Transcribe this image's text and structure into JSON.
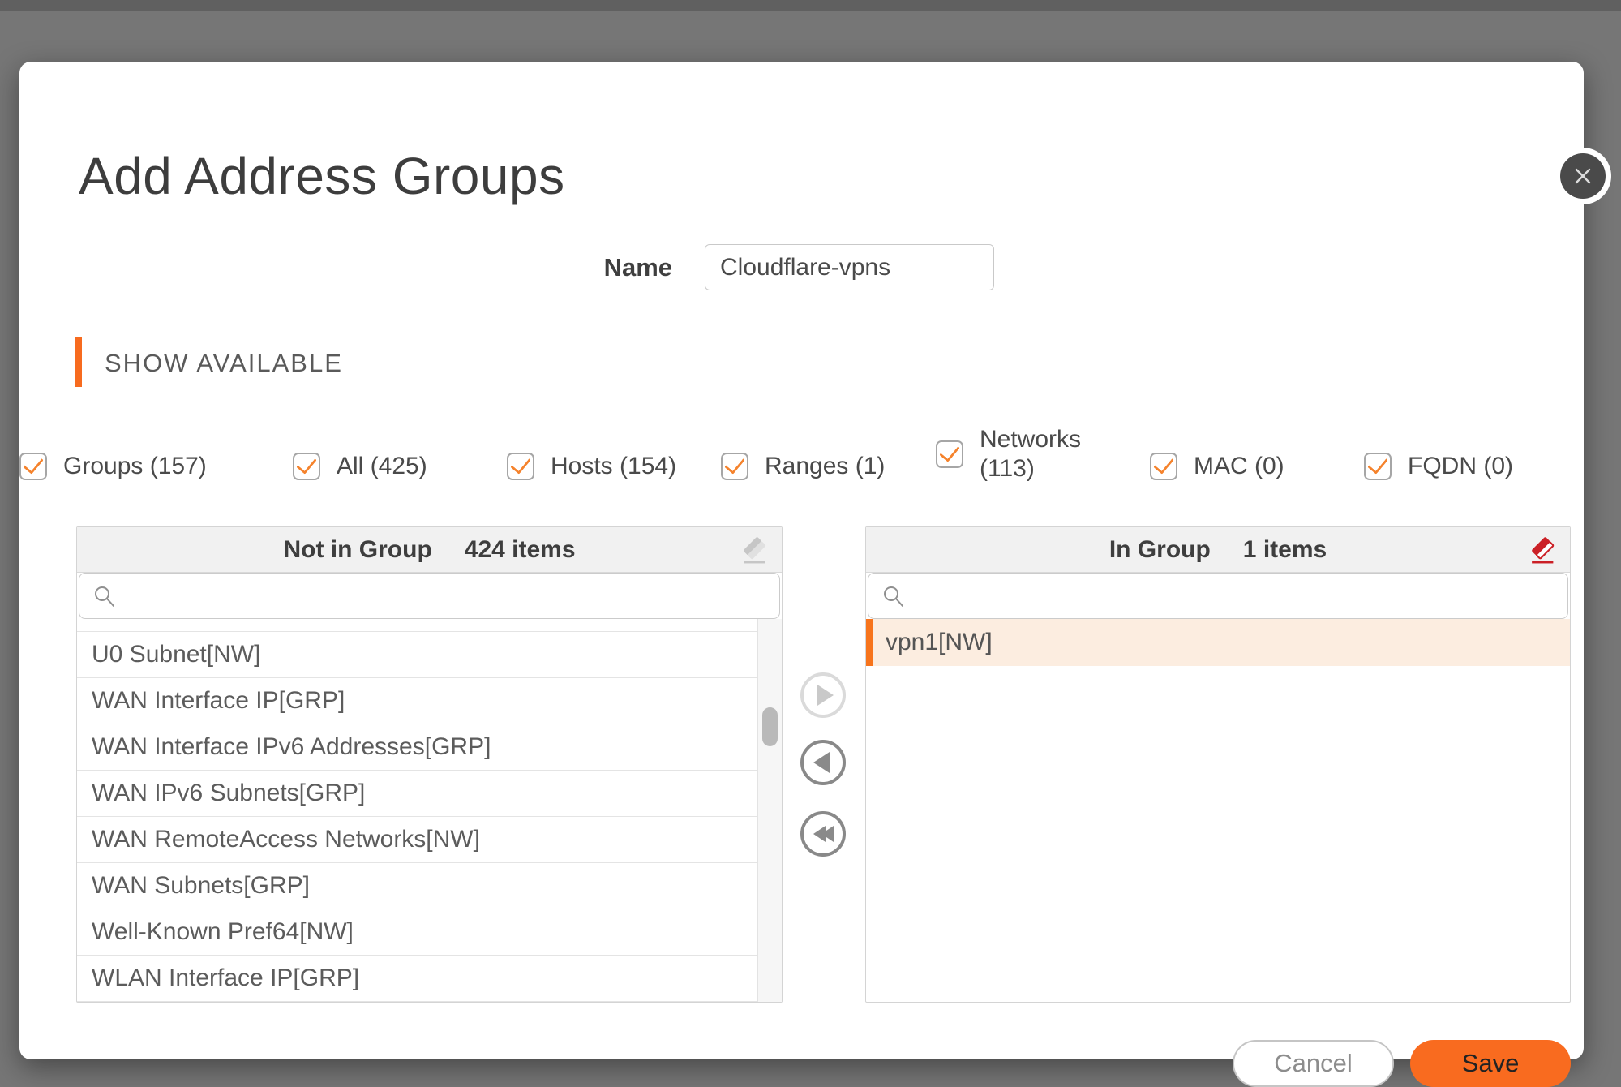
{
  "colors": {
    "accent": "#F76B1F",
    "check": "#F5832D",
    "selected-row-bg": "#FCEDE0",
    "selected-row-bar": "#F7741C",
    "eraser-red": "#CB2026",
    "save-bg": "#F96B1F",
    "overlay-bg": "#767676"
  },
  "modal": {
    "title": "Add Address Groups",
    "name_label": "Name",
    "name_value": "Cloudflare-vpns",
    "section_label": "SHOW AVAILABLE"
  },
  "filters": [
    {
      "label": "All (425)",
      "checked": true
    },
    {
      "label": "Hosts (154)",
      "checked": true
    },
    {
      "label": "Ranges (1)",
      "checked": true
    },
    {
      "label": "Networks (113)",
      "checked": true
    },
    {
      "label": "MAC (0)",
      "checked": true
    },
    {
      "label": "FQDN (0)",
      "checked": true
    },
    {
      "label": "Groups (157)",
      "checked": true
    }
  ],
  "not_in_group": {
    "title": "Not in Group",
    "count": "424 items",
    "search_value": "",
    "items": [
      "U0 Subnet[NW]",
      "WAN Interface IP[GRP]",
      "WAN Interface IPv6 Addresses[GRP]",
      "WAN IPv6 Subnets[GRP]",
      "WAN RemoteAccess Networks[NW]",
      "WAN Subnets[GRP]",
      "Well-Known Pref64[NW]",
      "WLAN Interface IP[GRP]"
    ]
  },
  "in_group": {
    "title": "In Group",
    "count": "1 items",
    "search_value": "",
    "items": [
      "vpn1[NW]"
    ]
  },
  "actions": {
    "cancel": "Cancel",
    "save": "Save"
  }
}
